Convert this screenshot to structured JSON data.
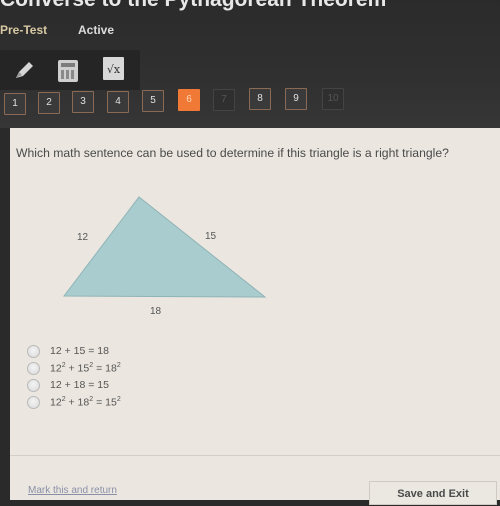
{
  "header": {
    "title": "Converse to the Pythagorean Theorem",
    "subtitle": "Pre-Test",
    "status": "Active"
  },
  "tools": [
    {
      "name": "pencil-icon"
    },
    {
      "name": "calculator-icon"
    },
    {
      "name": "formula-icon",
      "glyph": "√x"
    }
  ],
  "question_nav": {
    "current": 6,
    "items": [
      {
        "label": "1",
        "state": "normal"
      },
      {
        "label": "2",
        "state": "normal"
      },
      {
        "label": "3",
        "state": "normal"
      },
      {
        "label": "4",
        "state": "normal"
      },
      {
        "label": "5",
        "state": "normal"
      },
      {
        "label": "6",
        "state": "current"
      },
      {
        "label": "7",
        "state": "disabled"
      },
      {
        "label": "8",
        "state": "normal"
      },
      {
        "label": "9",
        "state": "normal"
      },
      {
        "label": "10",
        "state": "disabled"
      }
    ],
    "accent_color": "#f07a35"
  },
  "question": {
    "text": "Which math sentence can be used to determine if this triangle is a right triangle?",
    "figure": {
      "shape": "triangle",
      "fill_color": "#a9cccf",
      "side_labels": {
        "left": "12",
        "right": "15",
        "bottom": "18"
      }
    },
    "options": [
      {
        "html": "12 + 15 = 18"
      },
      {
        "html": "12<sup>2</sup> + 15<sup>2</sup> = 18<sup>2</sup>"
      },
      {
        "html": "12 + 18 = 15"
      },
      {
        "html": "12<sup>2</sup> + 18<sup>2</sup> = 15<sup>2</sup>"
      }
    ]
  },
  "footer": {
    "mark_label": "Mark this and return",
    "save_label": "Save and Exit"
  }
}
